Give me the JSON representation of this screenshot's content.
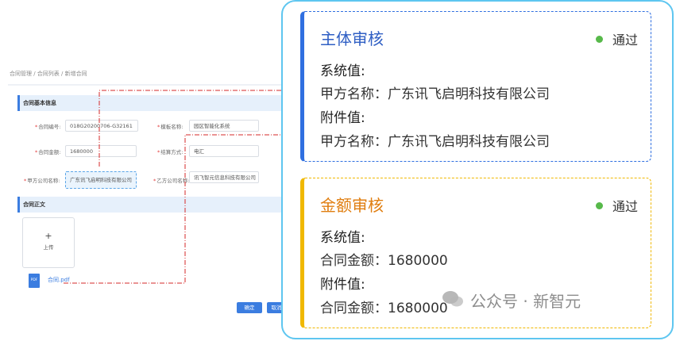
{
  "form": {
    "breadcrumb": "合同管理 / 合同列表 / 新增合同",
    "section_basic": "合同基本信息",
    "section_body": "合同正文",
    "fields": {
      "contract_no_label": "合同编号:",
      "contract_no_value": "018G20200706-G32161",
      "template_label": "模板名称:",
      "template_value": "园区智能化系统",
      "amount_label": "合同金额:",
      "amount_value": "1680000",
      "payment_label": "结算方式:",
      "payment_value": "电汇",
      "party_a_label": "甲方公司名称:",
      "party_a_value": "广东讯飞启明科技有限公司",
      "party_b_label": "乙方公司名称:",
      "party_b_value": "讯飞智元信息科技有限公司"
    },
    "upload_label": "上传",
    "upload_plus": "+",
    "attachment_icon": "PDF",
    "attachment_name": "合同.pdf",
    "confirm_label": "确定",
    "cancel_label": "取消"
  },
  "cards": [
    {
      "title": "主体审核",
      "status": "通过",
      "system_label": "系统值:",
      "system_value": "甲方名称：广东讯飞启明科技有限公司",
      "attach_label": "附件值:",
      "attach_value": "甲方名称：广东讯飞启明科技有限公司"
    },
    {
      "title": "金额审核",
      "status": "通过",
      "system_label": "系统值:",
      "system_value": "合同金额：1680000",
      "attach_label": "附件值:",
      "attach_value": "合同金额：1680000"
    }
  ],
  "watermark": "公众号 · 新智元",
  "colors": {
    "blue_accent": "#2f6fe0",
    "yellow_accent": "#f0b800",
    "status_green": "#57b94a",
    "panel_border": "#5ec6f0",
    "connector_red": "#d62a2a"
  }
}
